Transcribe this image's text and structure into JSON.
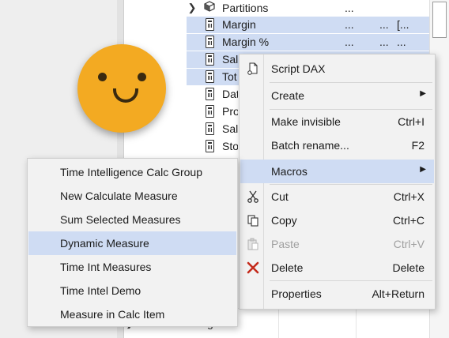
{
  "tree": {
    "rows": [
      {
        "name": "tree-row-partitions",
        "label": "Partitions",
        "c1": "...",
        "c2": "",
        "c3": "",
        "selected": false,
        "icon": "cube-icon",
        "expander": "›"
      },
      {
        "name": "tree-row-margin",
        "label": "Margin",
        "c1": "...",
        "c2": "...",
        "c3": "[...",
        "selected": true,
        "icon": "calculator-icon",
        "expander": ""
      },
      {
        "name": "tree-row-margin-pct",
        "label": "Margin %",
        "c1": "...",
        "c2": "...",
        "c3": "...",
        "selected": true,
        "icon": "calculator-icon",
        "expander": ""
      },
      {
        "name": "tree-row-sal",
        "label": "Sal",
        "c1": "",
        "c2": "",
        "c3": "",
        "selected": true,
        "icon": "calculator-icon",
        "expander": ""
      },
      {
        "name": "tree-row-tot",
        "label": "Tot",
        "c1": "",
        "c2": "",
        "c3": "",
        "selected": true,
        "icon": "calculator-icon",
        "expander": ""
      },
      {
        "name": "tree-row-dat",
        "label": "Dat",
        "c1": "",
        "c2": "",
        "c3": "",
        "selected": false,
        "icon": "column-icon",
        "expander": ""
      },
      {
        "name": "tree-row-pro",
        "label": "Pro",
        "c1": "",
        "c2": "",
        "c3": "",
        "selected": false,
        "icon": "column-icon",
        "expander": ""
      },
      {
        "name": "tree-row-sal2",
        "label": "Sal",
        "c1": "",
        "c2": "",
        "c3": "",
        "selected": false,
        "icon": "column-icon",
        "expander": ""
      },
      {
        "name": "tree-row-sto",
        "label": "Sto",
        "c1": "",
        "c2": "",
        "c3": "",
        "selected": false,
        "icon": "column-icon",
        "expander": ""
      }
    ],
    "bottom_row": {
      "expander": "›",
      "label": "Format String"
    }
  },
  "context_menu": {
    "script_dax": {
      "label": "Script DAX",
      "icon": "script-icon"
    },
    "create": {
      "label": "Create",
      "arrow": "▶"
    },
    "make_invisible": {
      "label": "Make invisible",
      "shortcut": "Ctrl+I"
    },
    "batch_rename": {
      "label": "Batch rename...",
      "shortcut": "F2"
    },
    "macros": {
      "label": "Macros",
      "arrow": "▶"
    },
    "cut": {
      "label": "Cut",
      "shortcut": "Ctrl+X",
      "icon": "scissors-icon"
    },
    "copy": {
      "label": "Copy",
      "shortcut": "Ctrl+C",
      "icon": "copy-icon"
    },
    "paste": {
      "label": "Paste",
      "shortcut": "Ctrl+V",
      "icon": "clipboard-icon"
    },
    "delete": {
      "label": "Delete",
      "shortcut": "Delete",
      "icon": "delete-x-icon"
    },
    "properties": {
      "label": "Properties",
      "shortcut": "Alt+Return"
    }
  },
  "macros_submenu": {
    "items": [
      "Time Intelligence Calc Group",
      "New Calculate Measure",
      "Sum Selected Measures",
      "Dynamic Measure",
      "Time Int Measures",
      "Time Intel Demo",
      "Measure in Calc Item"
    ],
    "highlighted_index": 3
  },
  "colors": {
    "selection": "#cfdcf3",
    "smiley": "#f3aa22",
    "delete_icon": "#c42b1c"
  }
}
